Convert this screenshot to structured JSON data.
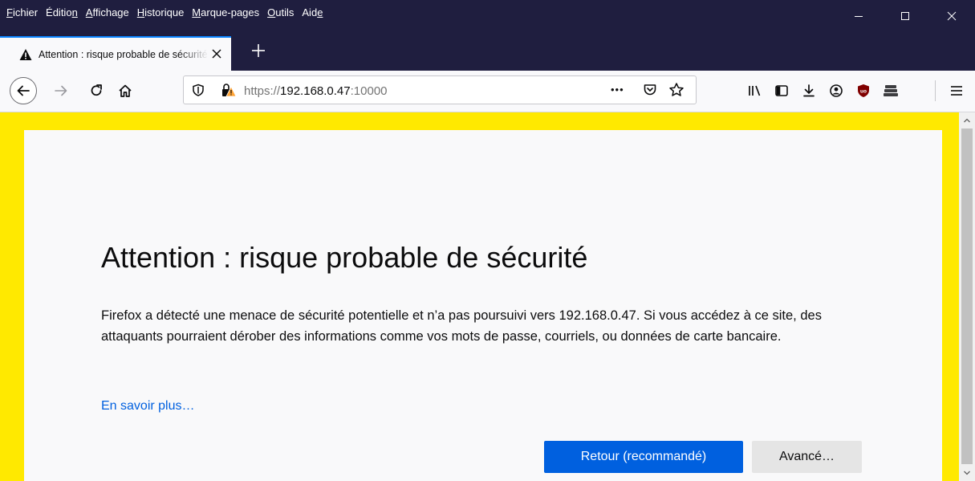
{
  "menubar": {
    "items": [
      {
        "label": "Fichier",
        "accel": "F",
        "rest": "ichier",
        "pre": ""
      },
      {
        "label": "Édition",
        "pre": "Éditio",
        "accel": "n",
        "rest": ""
      },
      {
        "label": "Affichage",
        "pre": "",
        "accel": "A",
        "rest": "ffichage"
      },
      {
        "label": "Historique",
        "pre": "",
        "accel": "H",
        "rest": "istorique"
      },
      {
        "label": "Marque-pages",
        "pre": "",
        "accel": "M",
        "rest": "arque-pages"
      },
      {
        "label": "Outils",
        "pre": "",
        "accel": "O",
        "rest": "utils"
      },
      {
        "label": "Aide",
        "pre": "Aid",
        "accel": "e",
        "rest": ""
      }
    ]
  },
  "tab": {
    "title": "Attention : risque probable de sécurité"
  },
  "urlbar": {
    "scheme": "https://",
    "host": "192.168.0.47",
    "port": ":10000",
    "more": "•••"
  },
  "page": {
    "title": "Attention : risque probable de sécurité",
    "description": "Firefox a détecté une menace de sécurité potentielle et n’a pas poursuivi vers 192.168.0.47. Si vous accédez à ce site, des attaquants pourraient dérober des informations comme vos mots de passe, courriels, ou données de carte bancaire.",
    "learn_more": "En savoir plus…",
    "back_button": "Retour (recommandé)",
    "advanced_button": "Avancé…"
  },
  "colors": {
    "chrome_dark": "#1f1e3f",
    "warning_yellow": "#ffe900",
    "primary_blue": "#0060df",
    "tab_accent": "#0a84ff"
  }
}
